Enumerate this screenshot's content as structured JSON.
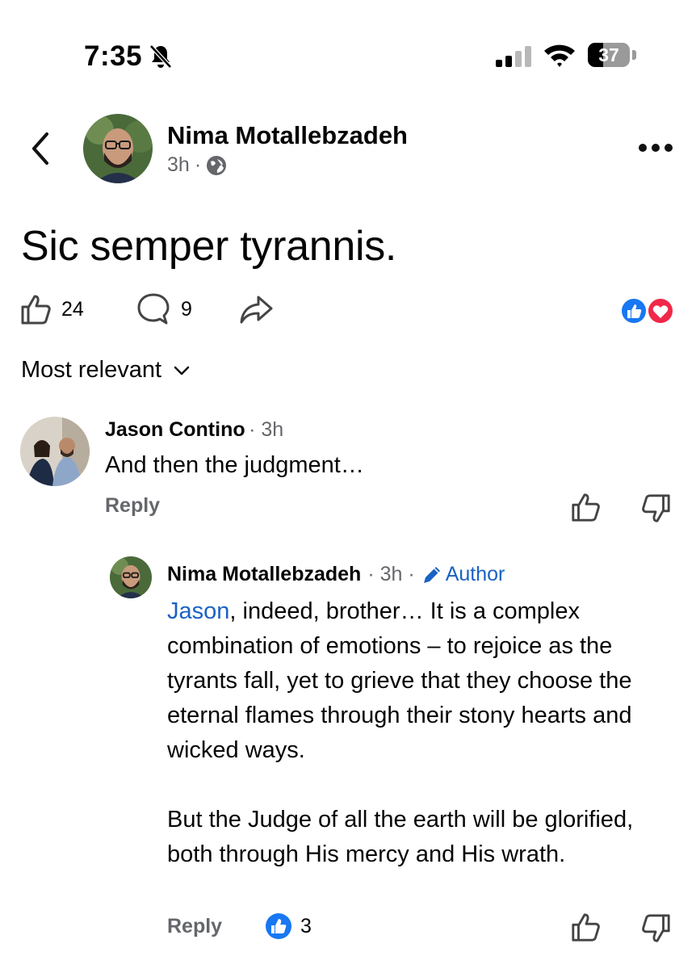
{
  "status_bar": {
    "time": "7:35",
    "battery": "37",
    "battery_level": 0.37
  },
  "post": {
    "author": "Nima Motallebzadeh",
    "age": "3h",
    "separator": "·",
    "privacy_icon": "globe-icon",
    "text": "Sic semper tyrannis.",
    "like_count": "24",
    "comment_count": "9",
    "reaction_icons": [
      "like-reaction-icon",
      "love-reaction-icon"
    ]
  },
  "sort": {
    "label": "Most relevant"
  },
  "comments": [
    {
      "author": "Jason Contino",
      "meta": "· 3h",
      "text": "And then the judgment…",
      "reply_label": "Reply"
    },
    {
      "author": "Nima Motallebzadeh",
      "meta": "· 3h ·",
      "badge": "Author",
      "mention": "Jason",
      "text_p1_rest": ", indeed, brother… It is a complex combination of emotions – to rejoice as the tyrants fall, yet to grieve that they choose the eternal flames through their stony hearts and wicked ways.",
      "text_p2": "But the Judge of all the earth will be glorified, both through His mercy and His wrath.",
      "reply_label": "Reply",
      "like_count": "3"
    }
  ],
  "colors": {
    "accent": "#1a62c4",
    "like_blue": "#1877f2",
    "love_red": "#f0284a",
    "secondary_text": "#65676b"
  }
}
